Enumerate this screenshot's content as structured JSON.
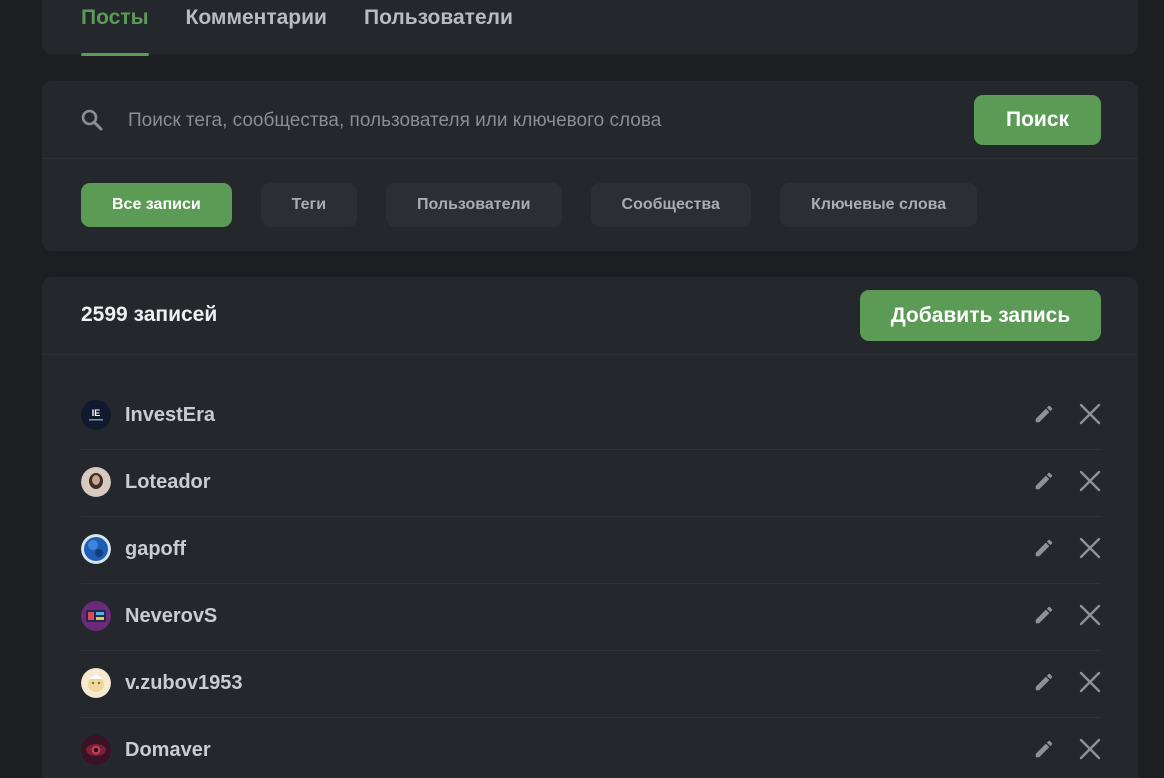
{
  "tabs": [
    {
      "label": "Посты",
      "active": true
    },
    {
      "label": "Комментарии",
      "active": false
    },
    {
      "label": "Пользователи",
      "active": false
    }
  ],
  "search": {
    "placeholder": "Поиск тега, сообщества, пользователя или ключевого слова",
    "value": "",
    "button_label": "Поиск",
    "icon": "search-icon"
  },
  "filters": [
    {
      "label": "Все записи",
      "active": true
    },
    {
      "label": "Теги",
      "active": false
    },
    {
      "label": "Пользователи",
      "active": false
    },
    {
      "label": "Сообщества",
      "active": false
    },
    {
      "label": "Ключевые слова",
      "active": false
    }
  ],
  "records": {
    "count_label": "2599 записей",
    "add_button_label": "Добавить запись",
    "items": [
      {
        "username": "InvestEra",
        "avatar_color": "#0f1a2e",
        "actions": [
          "edit-icon",
          "close-icon"
        ]
      },
      {
        "username": "Loteador",
        "avatar_color": "#d8c9bf",
        "actions": [
          "edit-icon",
          "close-icon"
        ]
      },
      {
        "username": "gapoff",
        "avatar_color": "#1e5fb5",
        "actions": [
          "edit-icon",
          "close-icon"
        ]
      },
      {
        "username": "NeverovS",
        "avatar_color": "#6b2a7a",
        "actions": [
          "edit-icon",
          "close-icon"
        ]
      },
      {
        "username": "v.zubov1953",
        "avatar_color": "#f1d79a",
        "actions": [
          "edit-icon",
          "close-icon"
        ]
      },
      {
        "username": "Domaver",
        "avatar_color": "#3a1226",
        "actions": [
          "edit-icon",
          "close-icon"
        ]
      }
    ]
  },
  "colors": {
    "accent": "#5b9b55",
    "background": "#1c1e21",
    "card": "#24272c"
  }
}
